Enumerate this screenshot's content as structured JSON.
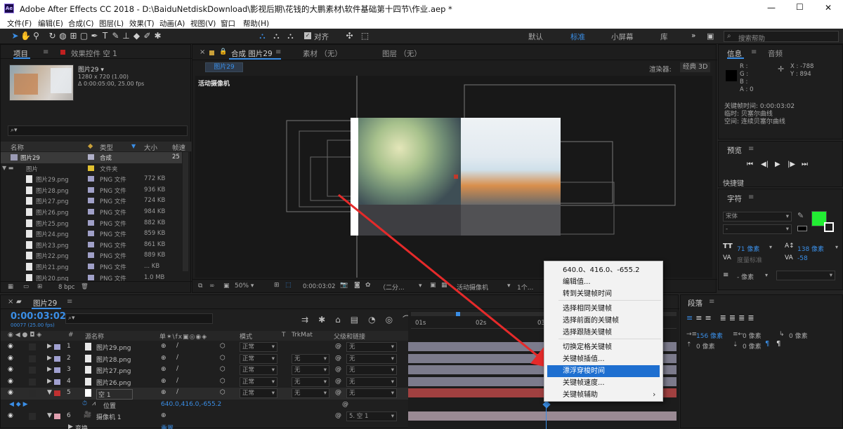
{
  "window": {
    "title": "Adobe After Effects CC 2018 - D:\\BaiduNetdiskDownload\\影视后期\\花钱的大鹏素材\\软件基础第十四节\\作业.aep *",
    "min": "—",
    "max": "☐",
    "close": "✕",
    "app_icon": "Ae"
  },
  "menu": [
    "文件(F)",
    "编辑(E)",
    "合成(C)",
    "图层(L)",
    "效果(T)",
    "动画(A)",
    "视图(V)",
    "窗口",
    "帮助(H)"
  ],
  "toolbar": {
    "align_label": "对齐",
    "workspaces": [
      "默认",
      "标准",
      "小屏幕",
      "库"
    ],
    "active_workspace": "标准",
    "more": "»",
    "search_placeholder": "搜索帮助"
  },
  "project": {
    "tab_project": "项目",
    "tab_effects": "效果控件 空 1",
    "item_name": "图片29 ▾",
    "item_res": "1280 x 720 (1.00)",
    "item_dur": "Δ 0:00:05:00, 25.00 fps",
    "search_icon": "⌕▾",
    "columns": [
      "名称",
      "类型",
      "大小",
      "帧速"
    ],
    "rows": [
      {
        "name": "图片29",
        "type": "合成",
        "size": "",
        "fps": "25",
        "color": "#b0b0c8",
        "kind": "comp"
      },
      {
        "name": "图片",
        "type": "文件夹",
        "size": "",
        "fps": "",
        "color": "#e0c030",
        "kind": "folder"
      },
      {
        "name": "图片29.png",
        "type": "PNG 文件",
        "size": "772 KB",
        "fps": "",
        "color": "#a0a0c8",
        "kind": "file"
      },
      {
        "name": "图片28.png",
        "type": "PNG 文件",
        "size": "936 KB",
        "fps": "",
        "color": "#a0a0c8",
        "kind": "file"
      },
      {
        "name": "图片27.png",
        "type": "PNG 文件",
        "size": "724 KB",
        "fps": "",
        "color": "#a0a0c8",
        "kind": "file"
      },
      {
        "name": "图片26.png",
        "type": "PNG 文件",
        "size": "984 KB",
        "fps": "",
        "color": "#a0a0c8",
        "kind": "file"
      },
      {
        "name": "图片25.png",
        "type": "PNG 文件",
        "size": "882 KB",
        "fps": "",
        "color": "#a0a0c8",
        "kind": "file"
      },
      {
        "name": "图片24.png",
        "type": "PNG 文件",
        "size": "859 KB",
        "fps": "",
        "color": "#a0a0c8",
        "kind": "file"
      },
      {
        "name": "图片23.png",
        "type": "PNG 文件",
        "size": "861 KB",
        "fps": "",
        "color": "#a0a0c8",
        "kind": "file"
      },
      {
        "name": "图片22.png",
        "type": "PNG 文件",
        "size": "889 KB",
        "fps": "",
        "color": "#a0a0c8",
        "kind": "file"
      },
      {
        "name": "图片21.png",
        "type": "PNG 文件",
        "size": "... KB",
        "fps": "",
        "color": "#a0a0c8",
        "kind": "file"
      },
      {
        "name": "图片20.png",
        "type": "PNG 文件",
        "size": "1.0 MB",
        "fps": "",
        "color": "#a0a0c8",
        "kind": "file"
      }
    ],
    "bpc": "8 bpc"
  },
  "comp": {
    "tab_label": "合成 图片29",
    "tab_footage": "素材 （无）",
    "tab_layer": "图层 （无）",
    "breadcrumb": "图片29",
    "renderer_label": "渲染器:",
    "renderer_value": "经典 3D",
    "camera_label": "活动摄像机",
    "zoom": "50%",
    "time": "0:00:03:02",
    "res": "（二分...",
    "view": "活动摄像机",
    "views": "1个..."
  },
  "info": {
    "tab_info": "信息",
    "tab_audio": "音频",
    "r": "R :",
    "g": "G :",
    "b": "B :",
    "a": "A : 0",
    "x": "X : -788",
    "y": "Y : 894",
    "kf_time": "关键帧时间: 0:00:03:02",
    "kf_temporal": "临时: 贝塞尔曲线",
    "kf_spatial": "空间: 连续贝塞尔曲线"
  },
  "preview": {
    "tab": "预览",
    "shortcut": "快捷键"
  },
  "character": {
    "tab": "字符",
    "font": "宋体",
    "style": "-",
    "size": "71 像素",
    "leading": "138 像素",
    "kerning": "度量标准",
    "tracking": "-58",
    "stroke": "- 像素",
    "fill_color": "#22ee33"
  },
  "paragraph": {
    "tab": "段落",
    "indent1": "156 像素",
    "indent2": "0 像素",
    "indent3": "0 像素",
    "space1": "0 像素",
    "space2": "0 像素"
  },
  "timeline": {
    "tab": "图片29",
    "timecode": "0:00:03:02",
    "sub_timecode": "00077 (25.00 fps)",
    "search_icon": "⌕▾",
    "columns": {
      "num": "#",
      "source": "源名称",
      "switches": "单✶\\fx▣◎◉◈",
      "mode": "模式",
      "t": "T",
      "trkmat": "TrkMat",
      "parent": "父级和链接"
    },
    "ruler": [
      "01s",
      "02s",
      "03s"
    ],
    "layers": [
      {
        "num": "1",
        "name": "图片29.png",
        "mode": "正常",
        "trkmat": "",
        "parent": "无",
        "label": "#a0a0d0",
        "bar": "#7c7b8c"
      },
      {
        "num": "2",
        "name": "图片28.png",
        "mode": "正常",
        "trkmat": "无",
        "parent": "无",
        "label": "#a0a0d0",
        "bar": "#7c7b8c"
      },
      {
        "num": "3",
        "name": "图片27.png",
        "mode": "正常",
        "trkmat": "无",
        "parent": "无",
        "label": "#a0a0d0",
        "bar": "#7c7b8c"
      },
      {
        "num": "4",
        "name": "图片26.png",
        "mode": "正常",
        "trkmat": "无",
        "parent": "无",
        "label": "#a0a0d0",
        "bar": "#7c7b8c"
      },
      {
        "num": "5",
        "name": "空 1",
        "mode": "正常",
        "trkmat": "无",
        "parent": "无",
        "label": "#c03030",
        "bar": "#a04040"
      },
      {
        "num": "6",
        "name": "摄像机 1",
        "mode": "",
        "trkmat": "",
        "parent": "5. 空 1",
        "label": "#e0a0b0",
        "bar": "#9a8a94"
      }
    ],
    "prop_name": "位置",
    "prop_value": "640.0,416.0,-655.2",
    "transform": "变换",
    "reset": "重置"
  },
  "context_menu": {
    "items": [
      "640.0、416.0、-655.2",
      "编辑值...",
      "转到关键帧时间",
      "选择相同关键帧",
      "选择前面的关键帧",
      "选择跟随关键帧",
      "切换定格关键帧",
      "关键帧插值...",
      "漂浮穿梭时间",
      "关键帧速度...",
      "关键帧辅助"
    ],
    "submenu_arrow": "›"
  }
}
